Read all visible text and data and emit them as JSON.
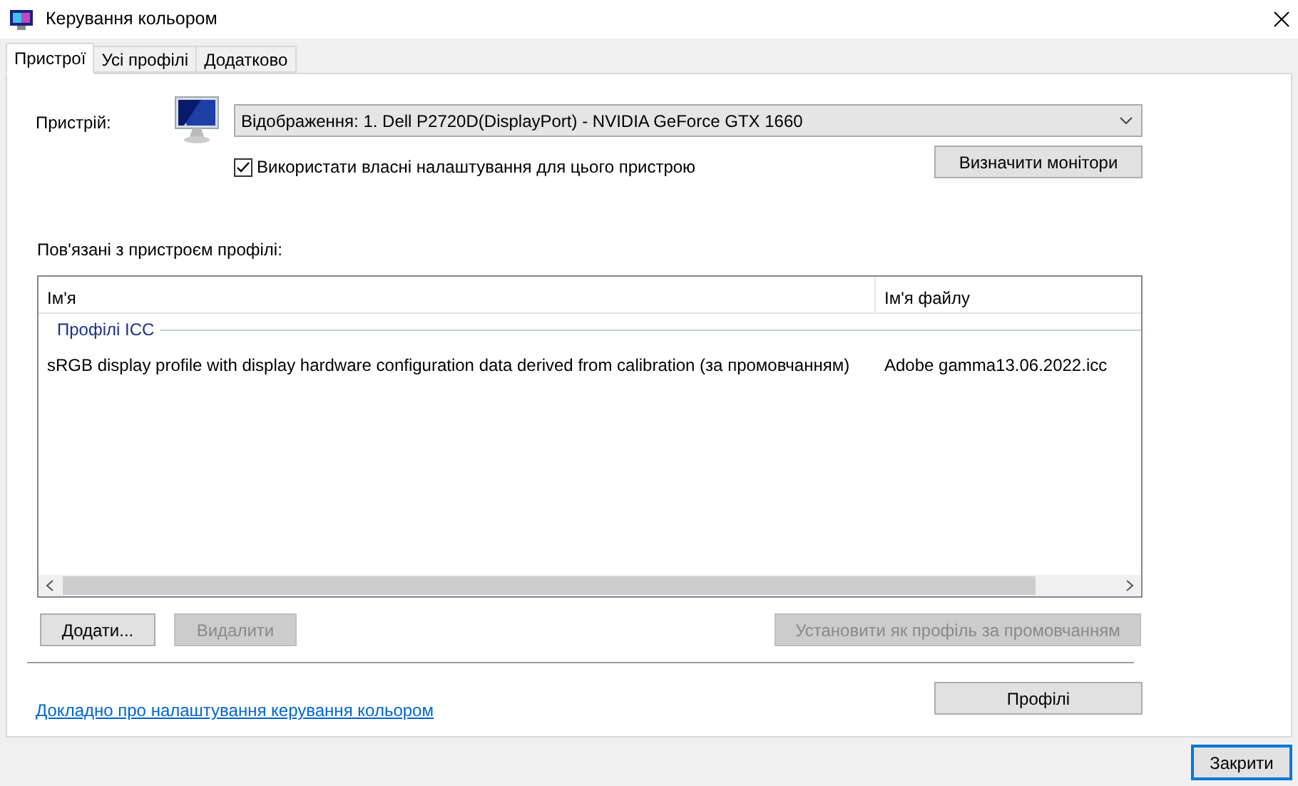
{
  "window": {
    "title": "Керування кольором"
  },
  "tabs": [
    {
      "label": "Пристрої",
      "selected": true
    },
    {
      "label": "Усі профілі",
      "selected": false
    },
    {
      "label": "Додатково",
      "selected": false
    }
  ],
  "device": {
    "label": "Пристрій:",
    "value": "Відображення: 1. Dell P2720D(DisplayPort) - NVIDIA GeForce GTX 1660",
    "use_own_settings": {
      "label": "Використати власні налаштування для цього пристрою",
      "checked": true
    },
    "identify_button": "Визначити монітори"
  },
  "profiles": {
    "title": "Пов'язані з пристроєм профілі:",
    "columns": [
      "Ім'я",
      "Ім'я файлу"
    ],
    "groups": [
      {
        "title": "Профілі ICC",
        "rows": [
          {
            "name": "sRGB display profile with display hardware configuration data derived from calibration (за промовчанням)",
            "file": "Adobe gamma13.06.2022.icc"
          }
        ]
      }
    ]
  },
  "profile_buttons": [
    {
      "label": "Додати...",
      "disabled": false
    },
    {
      "label": "Видалити",
      "disabled": true
    },
    {
      "label": "Установити як профіль за промовчанням",
      "disabled": true
    }
  ],
  "help_link": "Докладно про налаштування керування кольором",
  "profiles_button": "Профілі",
  "close_button": "Закрити"
}
